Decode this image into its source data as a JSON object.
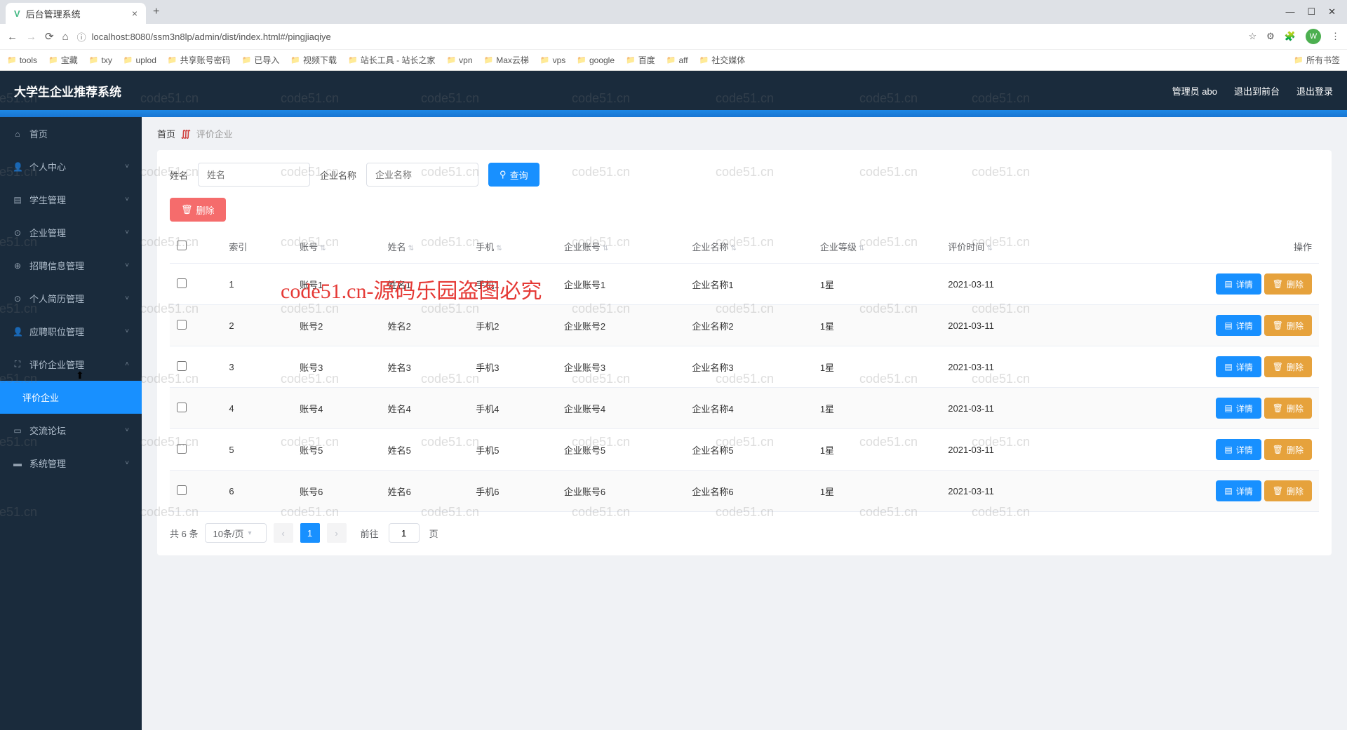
{
  "browser": {
    "tab_title": "后台管理系统",
    "url": "localhost:8080/ssm3n8lp/admin/dist/index.html#/pingjiaqiye",
    "avatar_letter": "W",
    "bookmarks": [
      "tools",
      "宝藏",
      "txy",
      "uplod",
      "共享账号密码",
      "已导入",
      "视频下载",
      "站长工具 - 站长之家",
      "vpn",
      "Max云梯",
      "vps",
      "google",
      "百度",
      "aff",
      "社交媒体"
    ],
    "bookmarks_right": "所有书签"
  },
  "header": {
    "app_title": "大学生企业推荐系统",
    "user": "管理员 abo",
    "logout_front": "退出到前台",
    "logout": "退出登录"
  },
  "sidebar": {
    "items": [
      {
        "icon": "⌂",
        "label": "首页",
        "chev": false
      },
      {
        "icon": "👤",
        "label": "个人中心",
        "chev": true
      },
      {
        "icon": "▤",
        "label": "学生管理",
        "chev": true
      },
      {
        "icon": "⊙",
        "label": "企业管理",
        "chev": true
      },
      {
        "icon": "⊕",
        "label": "招聘信息管理",
        "chev": true
      },
      {
        "icon": "⊙",
        "label": "个人简历管理",
        "chev": true
      },
      {
        "icon": "👤",
        "label": "应聘职位管理",
        "chev": true
      },
      {
        "icon": "⛶",
        "label": "评价企业管理",
        "chev": true,
        "open": true
      },
      {
        "icon": "",
        "label": "评价企业",
        "chev": false,
        "active": true
      },
      {
        "icon": "▭",
        "label": "交流论坛",
        "chev": true
      },
      {
        "icon": "▬",
        "label": "系统管理",
        "chev": true
      }
    ]
  },
  "breadcrumb": {
    "home": "首页",
    "current": "评价企业"
  },
  "search": {
    "name_label": "姓名",
    "name_ph": "姓名",
    "comp_label": "企业名称",
    "comp_ph": "企业名称",
    "query_btn": "查询",
    "delete_btn": "删除"
  },
  "table": {
    "headers": [
      "索引",
      "账号",
      "姓名",
      "手机",
      "企业账号",
      "企业名称",
      "企业等级",
      "评价时间",
      "操作"
    ],
    "detail_btn": "详情",
    "del_btn": "删除",
    "rows": [
      {
        "idx": "1",
        "acct": "账号1",
        "name": "姓名1",
        "phone": "手机1",
        "cacct": "企业账号1",
        "cname": "企业名称1",
        "rate": "1星",
        "time": "2021-03-11"
      },
      {
        "idx": "2",
        "acct": "账号2",
        "name": "姓名2",
        "phone": "手机2",
        "cacct": "企业账号2",
        "cname": "企业名称2",
        "rate": "1星",
        "time": "2021-03-11"
      },
      {
        "idx": "3",
        "acct": "账号3",
        "name": "姓名3",
        "phone": "手机3",
        "cacct": "企业账号3",
        "cname": "企业名称3",
        "rate": "1星",
        "time": "2021-03-11"
      },
      {
        "idx": "4",
        "acct": "账号4",
        "name": "姓名4",
        "phone": "手机4",
        "cacct": "企业账号4",
        "cname": "企业名称4",
        "rate": "1星",
        "time": "2021-03-11"
      },
      {
        "idx": "5",
        "acct": "账号5",
        "name": "姓名5",
        "phone": "手机5",
        "cacct": "企业账号5",
        "cname": "企业名称5",
        "rate": "1星",
        "time": "2021-03-11"
      },
      {
        "idx": "6",
        "acct": "账号6",
        "name": "姓名6",
        "phone": "手机6",
        "cacct": "企业账号6",
        "cname": "企业名称6",
        "rate": "1星",
        "time": "2021-03-11"
      }
    ]
  },
  "pagination": {
    "total": "共 6 条",
    "per_page": "10条/页",
    "current": "1",
    "goto_pre": "前往",
    "goto_val": "1",
    "goto_suf": "页"
  },
  "watermark": {
    "text": "code51.cn",
    "red": "code51.cn-源码乐园盗图必究"
  }
}
